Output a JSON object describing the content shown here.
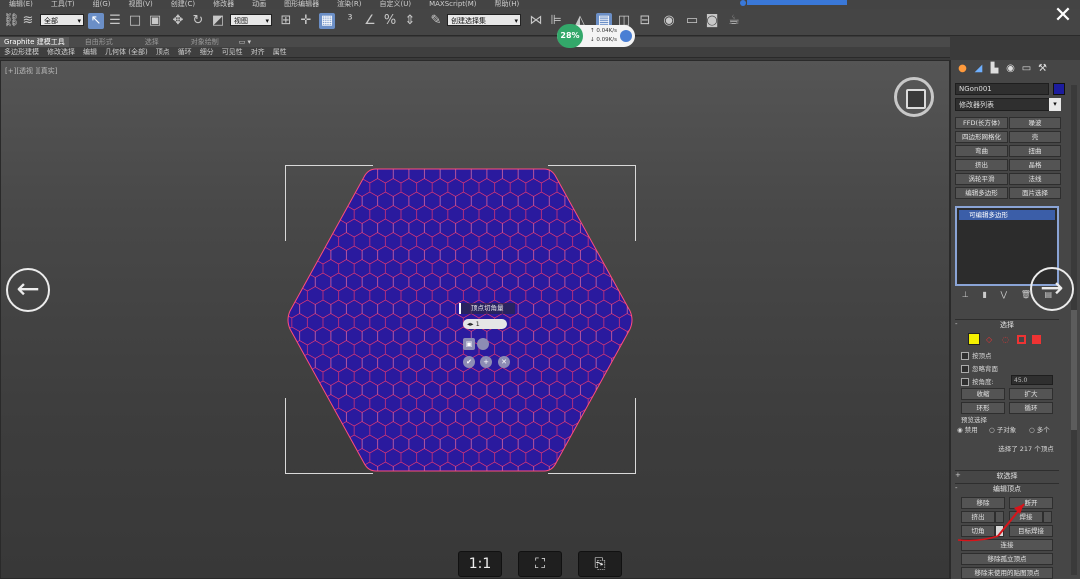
{
  "menubar": {
    "items": [
      "编辑(E)",
      "工具(T)",
      "组(G)",
      "视图(V)",
      "创建(C)",
      "修改器",
      "动画",
      "图形编辑器",
      "渲染(R)",
      "自定义(U)",
      "MAXScript(M)",
      "帮助(H)"
    ]
  },
  "toolbar": {
    "selection_filter": "全部",
    "ref_coord": "视图",
    "named_selection": "创建选择集"
  },
  "perf": {
    "percent": "28%",
    "up": "0.04K/s",
    "down": "0.09K/s"
  },
  "ribbon": {
    "tabs": [
      "Graphite 建模工具",
      "自由形式",
      "选择",
      "对象绘制"
    ],
    "sub": [
      "多边形建模",
      "修改选择",
      "编辑",
      "几何体 (全部)",
      "顶点",
      "循环",
      "细分",
      "可见性",
      "对齐",
      "属性"
    ]
  },
  "viewport": {
    "label": "[+][透视 ][真实]",
    "quad_label": "顶点切角量",
    "quad_value": "1"
  },
  "viewport_buttons": {
    "zoom_1_1": "1:1",
    "frame": "⛶",
    "snapshot": "⎘"
  },
  "cmd": {
    "object_name": "NGon001",
    "object_color": "#1c1c9e",
    "modifier_list": "修改器列表",
    "modifier_buttons": [
      "FFD(长方体)",
      "噪波",
      "四边形网格化",
      "壳",
      "弯曲",
      "扭曲",
      "挤出",
      "晶格",
      "涡轮平滑",
      "法线",
      "编辑多边形",
      "面片选择"
    ],
    "stack_item": "可编辑多边形",
    "selection_title": "选择",
    "by_vertex": "按顶点",
    "ignore_backfacing": "忽略背面",
    "by_angle": "按角度:",
    "angle_value": "45.0",
    "shrink": "收缩",
    "grow": "扩大",
    "ring": "环形",
    "loop": "循环",
    "preview_label": "预览选择",
    "disabled": "禁用",
    "subobject": "子对象",
    "multi": "多个",
    "selected_text": "选择了 217 个顶点",
    "soft_selection": "软选择",
    "edit_vertices": "编辑顶点",
    "remove": "移除",
    "break": "断开",
    "extrude": "挤出",
    "weld": "焊接",
    "chamfer": "切角",
    "target_weld": "目标焊接",
    "connect": "连接",
    "remove_isolated": "移除孤立顶点",
    "remove_unused": "移除未使用的贴图顶点"
  }
}
